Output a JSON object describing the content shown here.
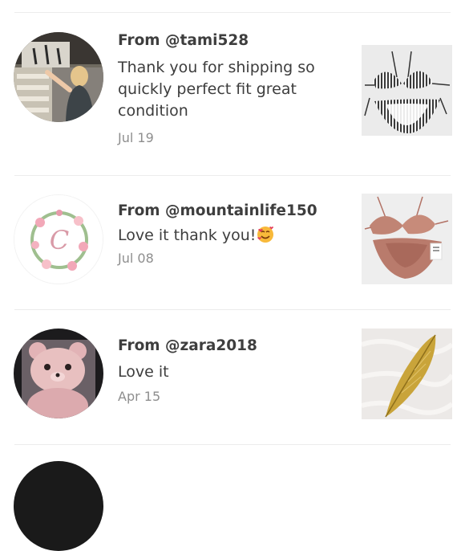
{
  "reviews": [
    {
      "from": "From @tami528",
      "comment": "Thank you for shipping so quickly perfect fit great condition",
      "date": "Jul 19",
      "avatar": "photo-woman-pointing",
      "thumbnail": "striped-bikini-photo"
    },
    {
      "from": "From @mountainlife150",
      "comment": "Love it thank you!",
      "comment_emoji": "smiling-face-with-hearts",
      "date": "Jul 08",
      "avatar": "floral-wreath-letter-c",
      "avatar_letter": "C",
      "thumbnail": "rose-bikini-photo"
    },
    {
      "from": "From @zara2018",
      "comment": "Love it",
      "date": "Apr 15",
      "avatar": "teddy-bear-photo",
      "thumbnail": "gold-feather-photo"
    }
  ]
}
